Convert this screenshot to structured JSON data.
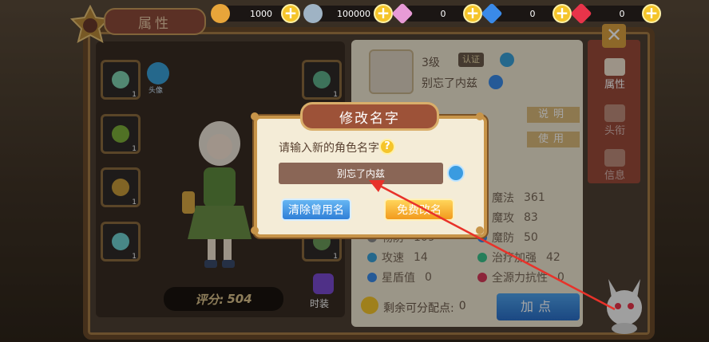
{
  "panel_title": "属性",
  "currencies": [
    {
      "name": "gold-coin",
      "value": "1000",
      "color": "#e8a53a"
    },
    {
      "name": "silver-coin",
      "value": "100000",
      "color": "#9fb3c4"
    },
    {
      "name": "pink-gem",
      "value": "0",
      "color": "#e89bd6"
    },
    {
      "name": "blue-gem",
      "value": "0",
      "color": "#3a8ae8"
    },
    {
      "name": "red-gem",
      "value": "0",
      "color": "#e8344a"
    }
  ],
  "player": {
    "level": "3级",
    "name": "别忘了内兹",
    "badge": "认证"
  },
  "equip_labels": {
    "headwear": "头像",
    "costume": "时装"
  },
  "slot_level": "1",
  "score": {
    "label": "评分:",
    "value": "504"
  },
  "side_tabs": [
    "属性",
    "头衔",
    "信息"
  ],
  "right_buttons": {
    "explain": "说明",
    "use": "使用",
    "add_points": "加点"
  },
  "stats": [
    {
      "label": "魔法",
      "value": "361"
    },
    {
      "label": "魔攻",
      "value": "83"
    },
    {
      "label": "物防",
      "value": "109"
    },
    {
      "label": "魔防",
      "value": "50"
    },
    {
      "label": "攻速",
      "value": "14"
    },
    {
      "label": "治疗加强",
      "value": "42"
    },
    {
      "label": "星盾值",
      "value": "0"
    },
    {
      "label": "全源力抗性",
      "value": "0"
    }
  ],
  "remaining_points": {
    "label": "剩余可分配点:",
    "value": "0"
  },
  "dialog": {
    "title": "修改名字",
    "prompt": "请输入新的角色名字",
    "name_value": "别忘了内兹",
    "clear_button": "清除曾用名",
    "free_rename_button": "免费改名"
  },
  "colors": {
    "arrow": "#e8322a",
    "dialog_bg": "#f4ecd7",
    "gold": "#f5c52b"
  }
}
